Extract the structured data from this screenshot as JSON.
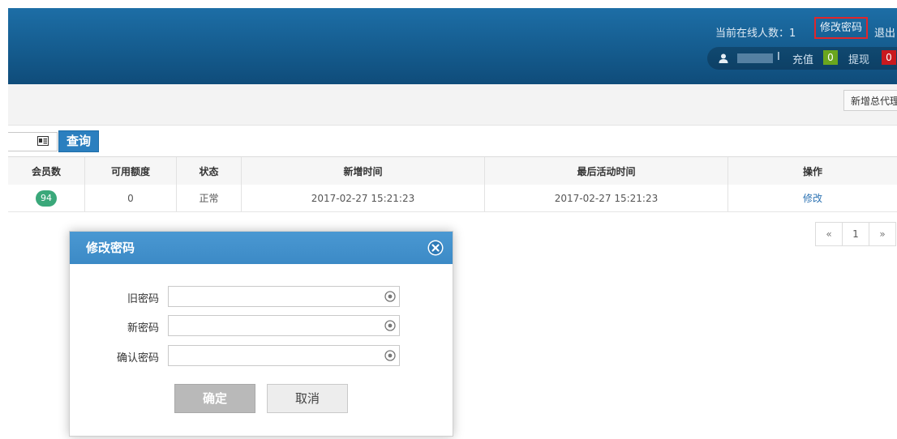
{
  "header": {
    "online_text": "当前在线人数：1",
    "change_password_link": "修改密码",
    "logout_link": "退出",
    "user_separator": "I",
    "recharge_label": "充值",
    "recharge_count": "0",
    "withdraw_label": "提现",
    "withdraw_count": "0",
    "icons": {
      "user": "user-icon"
    }
  },
  "toolbar": {
    "add_agent_button": "新增总代理"
  },
  "search": {
    "query_button": "查询",
    "icons": {
      "card": "id-card-icon"
    }
  },
  "table": {
    "columns": [
      "会员数",
      "可用额度",
      "状态",
      "新增时间",
      "最后活动时间",
      "操作"
    ],
    "rows": [
      {
        "member_count": "94",
        "available_credit": "0",
        "status": "正常",
        "created_time": "2017-02-27 15:21:23",
        "last_active_time": "2017-02-27 15:21:23",
        "action": "修改"
      }
    ]
  },
  "pagination": {
    "prev": "«",
    "current": "1",
    "next": "»"
  },
  "modal": {
    "title": "修改密码",
    "fields": [
      {
        "label": "旧密码",
        "value": ""
      },
      {
        "label": "新密码",
        "value": ""
      },
      {
        "label": "确认密码",
        "value": ""
      }
    ],
    "confirm_button": "确定",
    "cancel_button": "取消",
    "icons": {
      "close": "close-icon",
      "reveal": "eye-icon"
    }
  },
  "colors": {
    "header_blue": "#145a8c",
    "modal_header_blue": "#3c8ac6",
    "query_button_blue": "#2b7fbf",
    "badge_green": "#3aa87a",
    "recharge_green": "#6aa61e",
    "withdraw_red": "#c9191e",
    "highlight_red": "#e0262b"
  }
}
